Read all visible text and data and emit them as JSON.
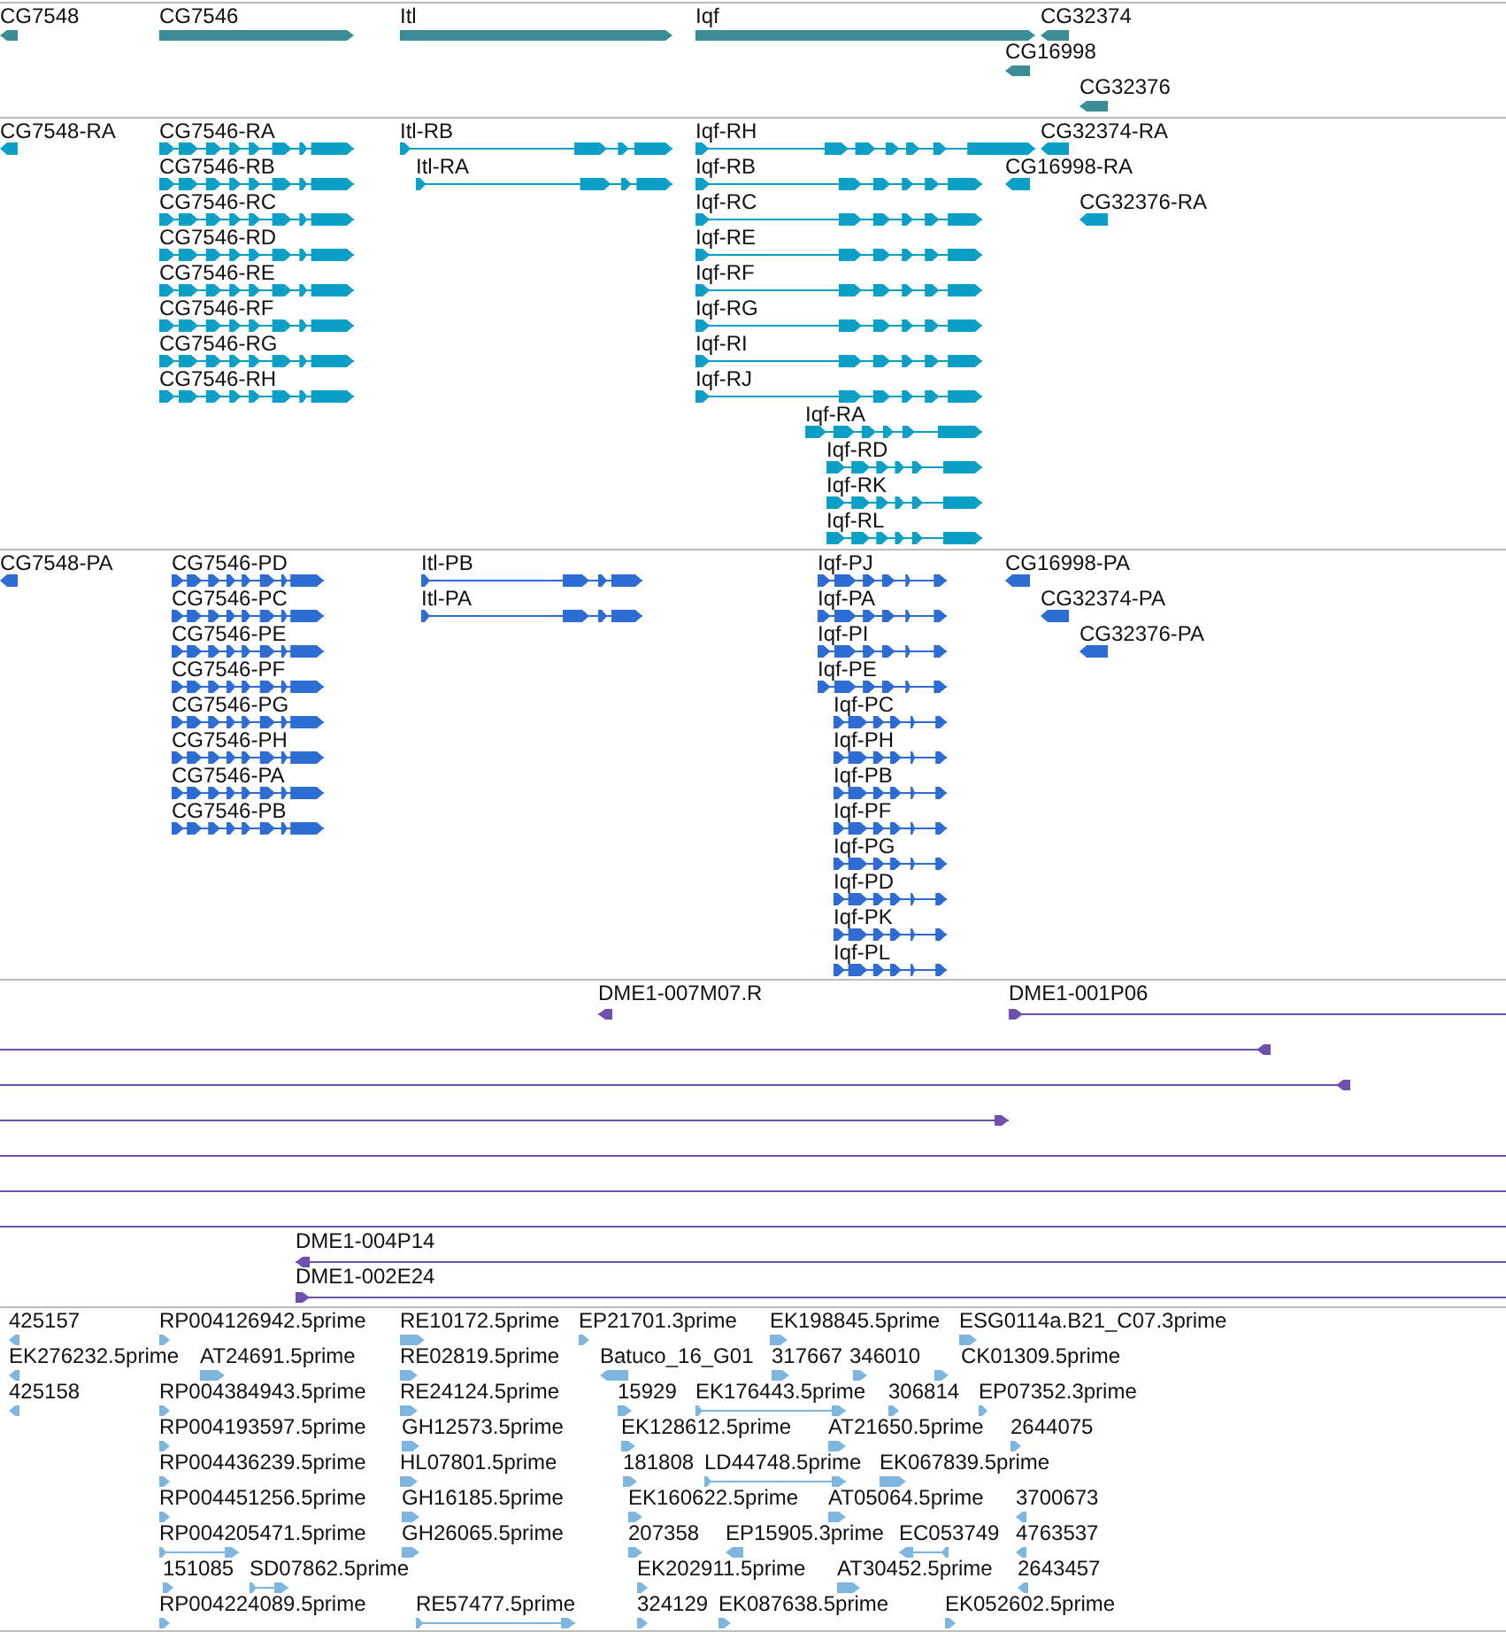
{
  "tracks": [
    {
      "kind": "gene",
      "features": [
        {
          "label": "CG7548",
          "reverse": true
        },
        {
          "label": "CG7546",
          "reverse": false
        },
        {
          "label": "Itl",
          "reverse": false
        },
        {
          "label": "Iqf",
          "reverse": false
        },
        {
          "label": "CG32374",
          "reverse": true
        },
        {
          "label": "CG16998",
          "reverse": true
        },
        {
          "label": "CG32376",
          "reverse": true
        }
      ]
    },
    {
      "kind": "transcript",
      "features": [
        {
          "label": "CG7548-RA",
          "reverse": true
        },
        {
          "label": "CG7546-RA",
          "reverse": false
        },
        {
          "label": "CG7546-RB",
          "reverse": false
        },
        {
          "label": "CG7546-RC",
          "reverse": false
        },
        {
          "label": "CG7546-RD",
          "reverse": false
        },
        {
          "label": "CG7546-RE",
          "reverse": false
        },
        {
          "label": "CG7546-RF",
          "reverse": false
        },
        {
          "label": "CG7546-RG",
          "reverse": false
        },
        {
          "label": "CG7546-RH",
          "reverse": false
        },
        {
          "label": "Itl-RB",
          "reverse": false
        },
        {
          "label": "Itl-RA",
          "reverse": false
        },
        {
          "label": "Iqf-RH",
          "reverse": false
        },
        {
          "label": "Iqf-RB",
          "reverse": false
        },
        {
          "label": "Iqf-RC",
          "reverse": false
        },
        {
          "label": "Iqf-RE",
          "reverse": false
        },
        {
          "label": "Iqf-RF",
          "reverse": false
        },
        {
          "label": "Iqf-RG",
          "reverse": false
        },
        {
          "label": "Iqf-RI",
          "reverse": false
        },
        {
          "label": "Iqf-RJ",
          "reverse": false
        },
        {
          "label": "Iqf-RA",
          "reverse": false
        },
        {
          "label": "Iqf-RD",
          "reverse": false
        },
        {
          "label": "Iqf-RK",
          "reverse": false
        },
        {
          "label": "Iqf-RL",
          "reverse": false
        },
        {
          "label": "CG32374-RA",
          "reverse": true
        },
        {
          "label": "CG16998-RA",
          "reverse": true
        },
        {
          "label": "CG32376-RA",
          "reverse": true
        }
      ]
    },
    {
      "kind": "protein",
      "features": [
        {
          "label": "CG7548-PA",
          "reverse": true
        },
        {
          "label": "CG7546-PD",
          "reverse": false
        },
        {
          "label": "CG7546-PC",
          "reverse": false
        },
        {
          "label": "CG7546-PE",
          "reverse": false
        },
        {
          "label": "CG7546-PF",
          "reverse": false
        },
        {
          "label": "CG7546-PG",
          "reverse": false
        },
        {
          "label": "CG7546-PH",
          "reverse": false
        },
        {
          "label": "CG7546-PA",
          "reverse": false
        },
        {
          "label": "CG7546-PB",
          "reverse": false
        },
        {
          "label": "Itl-PB",
          "reverse": false
        },
        {
          "label": "Itl-PA",
          "reverse": false
        },
        {
          "label": "Iqf-PJ",
          "reverse": false
        },
        {
          "label": "Iqf-PA",
          "reverse": false
        },
        {
          "label": "Iqf-PI",
          "reverse": false
        },
        {
          "label": "Iqf-PE",
          "reverse": false
        },
        {
          "label": "Iqf-PC",
          "reverse": false
        },
        {
          "label": "Iqf-PH",
          "reverse": false
        },
        {
          "label": "Iqf-PB",
          "reverse": false
        },
        {
          "label": "Iqf-PF",
          "reverse": false
        },
        {
          "label": "Iqf-PG",
          "reverse": false
        },
        {
          "label": "Iqf-PD",
          "reverse": false
        },
        {
          "label": "Iqf-PK",
          "reverse": false
        },
        {
          "label": "Iqf-PL",
          "reverse": false
        },
        {
          "label": "CG16998-PA",
          "reverse": true
        },
        {
          "label": "CG32374-PA",
          "reverse": true
        },
        {
          "label": "CG32376-PA",
          "reverse": true
        }
      ]
    },
    {
      "kind": "clone",
      "features": [
        {
          "kind": "arrow",
          "label": "DME1-007M07.R",
          "reverse": true
        },
        {
          "kind": "arrow",
          "label": "DME1-001P06",
          "reverse": false
        },
        {
          "kind": "arrow",
          "reverse": true
        },
        {
          "kind": "arrow",
          "reverse": true
        },
        {
          "kind": "arrow",
          "reverse": false
        },
        {
          "kind": "line"
        },
        {
          "kind": "line"
        },
        {
          "kind": "line"
        },
        {
          "kind": "arrow",
          "label": "DME1-004P14",
          "reverse": true
        },
        {
          "kind": "arrow",
          "label": "DME1-002E24",
          "reverse": false
        }
      ]
    },
    {
      "kind": "est",
      "features": [
        {
          "label": "425157",
          "reverse": true
        },
        {
          "label": "RP004126942.5prime",
          "reverse": false
        },
        {
          "label": "RE10172.5prime",
          "reverse": false
        },
        {
          "label": "EP21701.3prime",
          "reverse": false
        },
        {
          "label": "EK198845.5prime",
          "reverse": false
        },
        {
          "label": "ESG0114a.B21_C07.3prime",
          "reverse": false
        },
        {
          "label": "EK276232.5prime",
          "reverse": true
        },
        {
          "label": "AT24691.5prime",
          "reverse": false
        },
        {
          "label": "RE02819.5prime",
          "reverse": false
        },
        {
          "label": "Batuco_16_G01",
          "reverse": true
        },
        {
          "label": "317667",
          "reverse": false
        },
        {
          "label": "346010",
          "reverse": false
        },
        {
          "label": "CK01309.5prime",
          "reverse": false
        },
        {
          "label": "425158",
          "reverse": true
        },
        {
          "label": "RP004384943.5prime",
          "reverse": false
        },
        {
          "label": "RE24124.5prime",
          "reverse": false
        },
        {
          "label": "15929",
          "reverse": false
        },
        {
          "label": "EK176443.5prime",
          "reverse": false
        },
        {
          "label": "306814",
          "reverse": false
        },
        {
          "label": "EP07352.3prime",
          "reverse": false
        },
        {
          "label": "RP004193597.5prime",
          "reverse": false
        },
        {
          "label": "GH12573.5prime",
          "reverse": false
        },
        {
          "label": "EK128612.5prime",
          "reverse": false
        },
        {
          "label": "AT21650.5prime",
          "reverse": false
        },
        {
          "label": "2644075",
          "reverse": false
        },
        {
          "label": "RP004436239.5prime",
          "reverse": false
        },
        {
          "label": "HL07801.5prime",
          "reverse": false
        },
        {
          "label": "181808",
          "reverse": false
        },
        {
          "label": "LD44748.5prime",
          "reverse": false
        },
        {
          "label": "EK067839.5prime",
          "reverse": false
        },
        {
          "label": "RP004451256.5prime",
          "reverse": false
        },
        {
          "label": "GH16185.5prime",
          "reverse": false
        },
        {
          "label": "EK160622.5prime",
          "reverse": false
        },
        {
          "label": "AT05064.5prime",
          "reverse": false
        },
        {
          "label": "3700673",
          "reverse": true
        },
        {
          "label": "RP004205471.5prime",
          "reverse": false
        },
        {
          "label": "GH26065.5prime",
          "reverse": false
        },
        {
          "label": "207358",
          "reverse": false
        },
        {
          "label": "EP15905.3prime",
          "reverse": true
        },
        {
          "label": "EC053749",
          "reverse": true
        },
        {
          "label": "4763537",
          "reverse": true
        },
        {
          "label": "151085",
          "reverse": false
        },
        {
          "label": "SD07862.5prime",
          "reverse": false
        },
        {
          "label": "EK202911.5prime",
          "reverse": false
        },
        {
          "label": "AT30452.5prime",
          "reverse": false
        },
        {
          "label": "2643457",
          "reverse": true
        },
        {
          "label": "RP004224089.5prime",
          "reverse": false
        },
        {
          "label": "RE57477.5prime",
          "reverse": false
        },
        {
          "label": "324129",
          "reverse": false
        },
        {
          "label": "EK087638.5prime",
          "reverse": false
        },
        {
          "label": "EK052602.5prime",
          "reverse": false
        }
      ]
    }
  ]
}
